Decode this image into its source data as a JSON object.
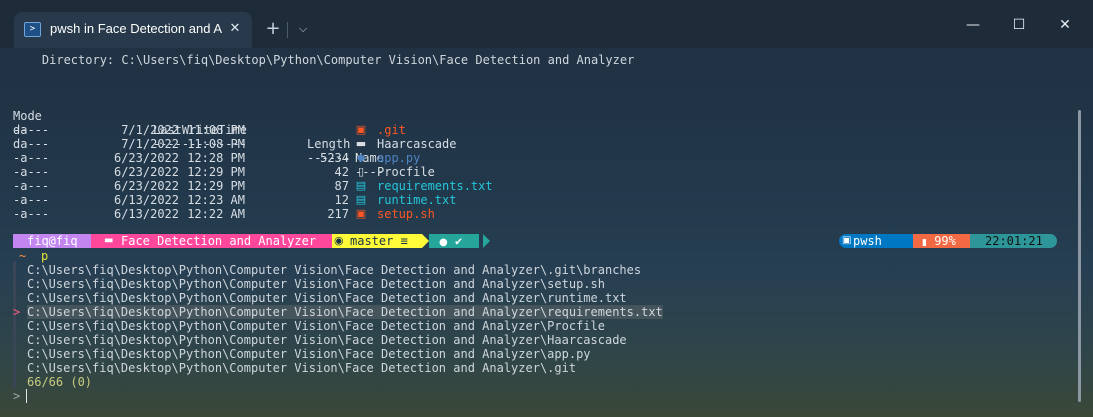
{
  "titlebar": {
    "tab_title": "pwsh in Face Detection and A",
    "tab_icon": "terminal-icon",
    "close_glyph": "✕",
    "newtab_glyph": "+",
    "dropdown_glyph": "⌵",
    "minimize_glyph": "—",
    "maximize_glyph": "☐",
    "window_close_glyph": "✕"
  },
  "listing": {
    "directory_line": "    Directory: C:\\Users\\fiq\\Desktop\\Python\\Computer Vision\\Face Detection and Analyzer",
    "headers": {
      "mode": "Mode",
      "lwt": "LastWriteTime",
      "length": "Length",
      "name": "Name"
    },
    "dashes": {
      "mode": "----",
      "lwt": "-------------",
      "length": "------",
      "name": "----"
    },
    "rows": [
      {
        "mode": "da---",
        "date": "7/1/2022",
        "time": "11:08 PM",
        "length": "",
        "icon": "git-folder-icon",
        "glyph": "▣",
        "name": ".git",
        "color": "#ff5722"
      },
      {
        "mode": "da---",
        "date": "7/1/2022",
        "time": "11:08 PM",
        "length": "",
        "icon": "folder-icon",
        "glyph": "▬",
        "name": "Haarcascade",
        "color": "#d8dee4"
      },
      {
        "mode": "-a---",
        "date": "6/23/2022",
        "time": "12:28 PM",
        "length": "5234",
        "icon": "python-icon",
        "glyph": "◆",
        "name": "app.py",
        "color": "#4f84c4"
      },
      {
        "mode": "-a---",
        "date": "6/23/2022",
        "time": "12:29 PM",
        "length": "42",
        "icon": "file-icon",
        "glyph": "▯",
        "name": "Procfile",
        "color": "#d8dee4"
      },
      {
        "mode": "-a---",
        "date": "6/23/2022",
        "time": "12:29 PM",
        "length": "87",
        "icon": "text-file-icon",
        "glyph": "▤",
        "name": "requirements.txt",
        "color": "#26c6da"
      },
      {
        "mode": "-a---",
        "date": "6/13/2022",
        "time": "12:23 AM",
        "length": "12",
        "icon": "text-file-icon",
        "glyph": "▤",
        "name": "runtime.txt",
        "color": "#26c6da"
      },
      {
        "mode": "-a---",
        "date": "6/13/2022",
        "time": "12:22 AM",
        "length": "217",
        "icon": "shell-script-icon",
        "glyph": "▣",
        "name": "setup.sh",
        "color": "#ff5722"
      }
    ]
  },
  "prompt": {
    "user": "fiq@fiq",
    "path": "Face Detection and Analyzer",
    "branch": "master ≡",
    "status": "✔",
    "shell": "pwsh",
    "battery": "99%",
    "time": "22:01:21",
    "colors": {
      "user": "#c386f1",
      "path": "#ff479c",
      "git": "#fffb38",
      "status": "#26a69a",
      "shell": "#0077c2",
      "battery": "#f36943",
      "time": "#2e9599"
    }
  },
  "command": {
    "tilde": "~",
    "text": "p"
  },
  "results": {
    "items": [
      "C:\\Users\\fiq\\Desktop\\Python\\Computer Vision\\Face Detection and Analyzer\\.git\\branches",
      "C:\\Users\\fiq\\Desktop\\Python\\Computer Vision\\Face Detection and Analyzer\\setup.sh",
      "C:\\Users\\fiq\\Desktop\\Python\\Computer Vision\\Face Detection and Analyzer\\runtime.txt",
      "C:\\Users\\fiq\\Desktop\\Python\\Computer Vision\\Face Detection and Analyzer\\requirements.txt",
      "C:\\Users\\fiq\\Desktop\\Python\\Computer Vision\\Face Detection and Analyzer\\Procfile",
      "C:\\Users\\fiq\\Desktop\\Python\\Computer Vision\\Face Detection and Analyzer\\Haarcascade",
      "C:\\Users\\fiq\\Desktop\\Python\\Computer Vision\\Face Detection and Analyzer\\app.py",
      "C:\\Users\\fiq\\Desktop\\Python\\Computer Vision\\Face Detection and Analyzer\\.git"
    ],
    "selected_index": 3,
    "selector": ">",
    "count": "66/66 (0)",
    "input_prompt": ">"
  }
}
